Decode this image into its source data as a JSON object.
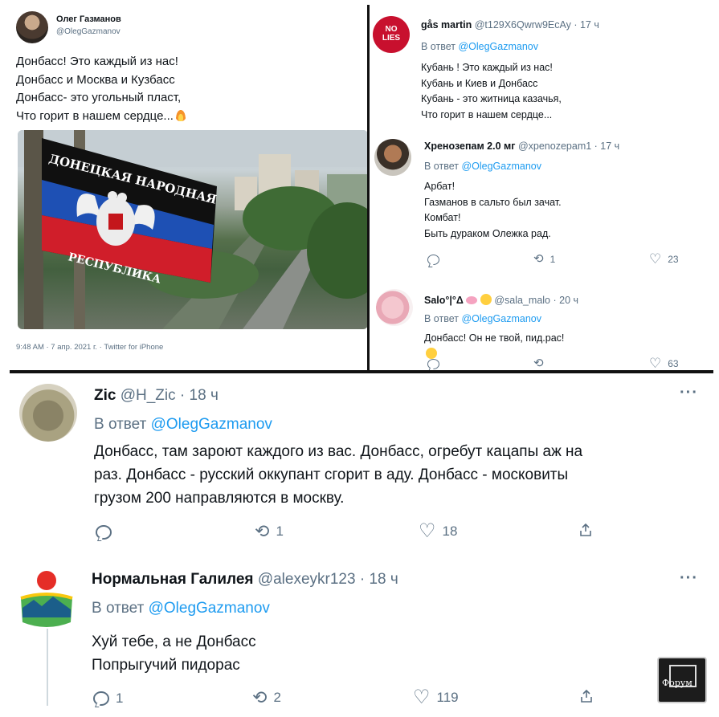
{
  "main_tweet": {
    "author_name": "Олег Газманов",
    "author_handle": "@OlegGazmanov",
    "text_lines": [
      "Донбасс! Это каждый из нас!",
      "Донбасс и Москва и Кузбасс",
      "Донбасс- это угольный пласт,",
      "Что горит в нашем сердце..."
    ],
    "emoji": "fire-emoji",
    "photo_flag_top": "ДОНЕЦКАЯ НАРОДНАЯ",
    "photo_flag_bottom": "РЕСПУБЛИКА",
    "meta": "9:48 AM · 7 апр. 2021 г. · Twitter for iPhone"
  },
  "replies_small": [
    {
      "avatar": "no-lies-logo",
      "avatar_text": "NO LIES",
      "name": "gås martin",
      "handle": "@t129X6Qwrw9EcAy",
      "time": "· 17 ч",
      "reply_prefix": "В ответ",
      "reply_mention": "@OlegGazmanov",
      "text_lines": [
        "Кубань ! Это каждый из нас!",
        "Кубань  и Киев  и Донбасс",
        "Кубань - это житница казачья,",
        "Что горит в нашем сердце..."
      ]
    },
    {
      "avatar": "portrait-avatar",
      "name": "Хренозепам 2.0 мг",
      "handle": "@xpenozepam1",
      "time": "· 17 ч",
      "reply_prefix": "В ответ",
      "reply_mention": "@OlegGazmanov",
      "text_lines": [
        "Арбат!",
        "Газманов в сальто был зачат.",
        "Комбат!",
        "Быть дураком Олежка рад."
      ],
      "retweets": "1",
      "likes": "23"
    },
    {
      "avatar": "salo-avatar",
      "name": "Salo°|°Δ",
      "name_emojis": [
        "brain-emoji",
        "relieved-face-emoji"
      ],
      "handle": "@sala_malo",
      "time": "· 20 ч",
      "reply_prefix": "В ответ",
      "reply_mention": "@OlegGazmanov",
      "text_lines": [
        "Донбасс! Он не твой, пид.рас!"
      ],
      "text_emoji": "smiling-face-emoji",
      "likes": "63"
    }
  ],
  "replies_large": [
    {
      "avatar": "rock-avatar",
      "name": "Zic",
      "handle": "@H_Zic",
      "time": "· 18 ч",
      "reply_prefix": "В ответ",
      "reply_mention": "@OlegGazmanov",
      "text_lines": [
        "Донбасс, там зароют каждого из вас. Донбасс, огребут кацапы аж на",
        "раз. Донбасс - русский оккупант сгорит в аду. Донбасс - московиты",
        "грузом 200 направляются в москву."
      ],
      "replies": "",
      "retweets": "1",
      "likes": "18"
    },
    {
      "avatar": "emblem-avatar",
      "name": "Нормальная Галилея",
      "handle": "@alexeykr123",
      "time": "· 18 ч",
      "reply_prefix": "В ответ",
      "reply_mention": "@OlegGazmanov",
      "text_lines": [
        "Хуй тебе, а не Донбасс",
        "Попрыгучий пидорас"
      ],
      "replies": "1",
      "retweets": "2",
      "likes": "119"
    }
  ],
  "icons": {
    "more": "more-options-icon",
    "reply": "reply-icon",
    "retweet": "retweet-icon",
    "like": "like-icon",
    "share": "share-icon"
  },
  "watermark": {
    "label": "Форум"
  },
  "colors": {
    "link": "#1d9bf0",
    "muted": "#5b7083",
    "text": "#0f1419"
  }
}
